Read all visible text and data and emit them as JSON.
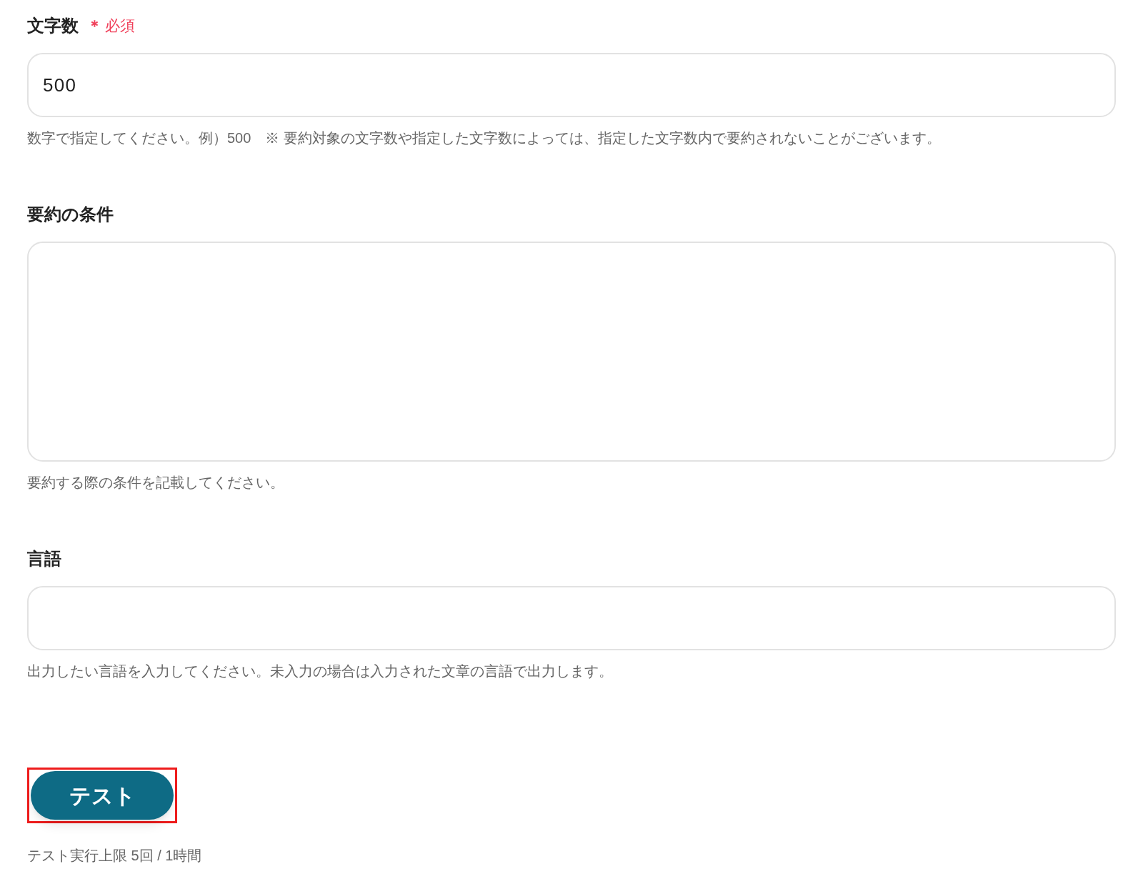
{
  "fields": [
    {
      "kind": "input",
      "label": "文字数",
      "required": true,
      "required_mark": "＊",
      "required_label": "必須",
      "value": "500",
      "help": "数字で指定してください。例）500　※ 要約対象の文字数や指定した文字数によっては、指定した文字数内で要約されないことがございます。"
    },
    {
      "kind": "textarea",
      "label": "要約の条件",
      "help": "要約する際の条件を記載してください。"
    },
    {
      "kind": "input",
      "label": "言語",
      "help": "出力したい言語を入力してください。未入力の場合は入力された文章の言語で出力します。"
    }
  ],
  "test_button": {
    "label": "テスト",
    "highlighted": true
  },
  "limit_note": "テスト実行上限 5回 / 1時間"
}
